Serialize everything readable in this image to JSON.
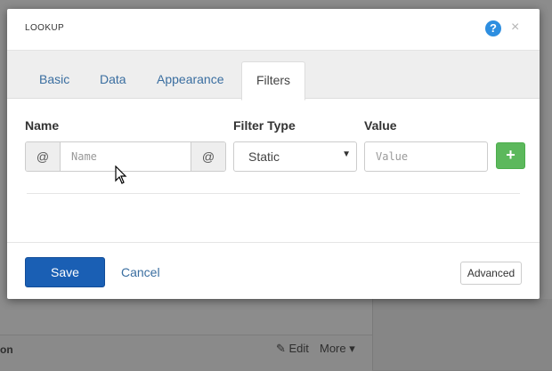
{
  "background": {
    "section_label": "on",
    "edit_label": "Edit",
    "more_label": "More"
  },
  "modal": {
    "title": "LOOKUP",
    "help_icon": "question-circle-icon",
    "close_icon": "close-icon",
    "help_glyph": "?",
    "close_glyph": "×"
  },
  "tabs": [
    {
      "label": "Basic",
      "active": false
    },
    {
      "label": "Data",
      "active": false
    },
    {
      "label": "Appearance",
      "active": false
    },
    {
      "label": "Filters",
      "active": true
    }
  ],
  "filters": {
    "name_label": "Name",
    "filter_type_label": "Filter Type",
    "value_label": "Value",
    "name_prefix": "@",
    "name_suffix": "@",
    "name_placeholder": "Name",
    "name_value": "",
    "filter_type_selected": "Static",
    "value_placeholder": "Value",
    "value_value": "",
    "add_glyph": "+"
  },
  "footer": {
    "save_label": "Save",
    "cancel_label": "Cancel",
    "advanced_label": "Advanced"
  },
  "colors": {
    "primary": "#1a5fb4",
    "success": "#5cb85c",
    "link": "#3a6ea0",
    "help": "#2d8ee0"
  }
}
